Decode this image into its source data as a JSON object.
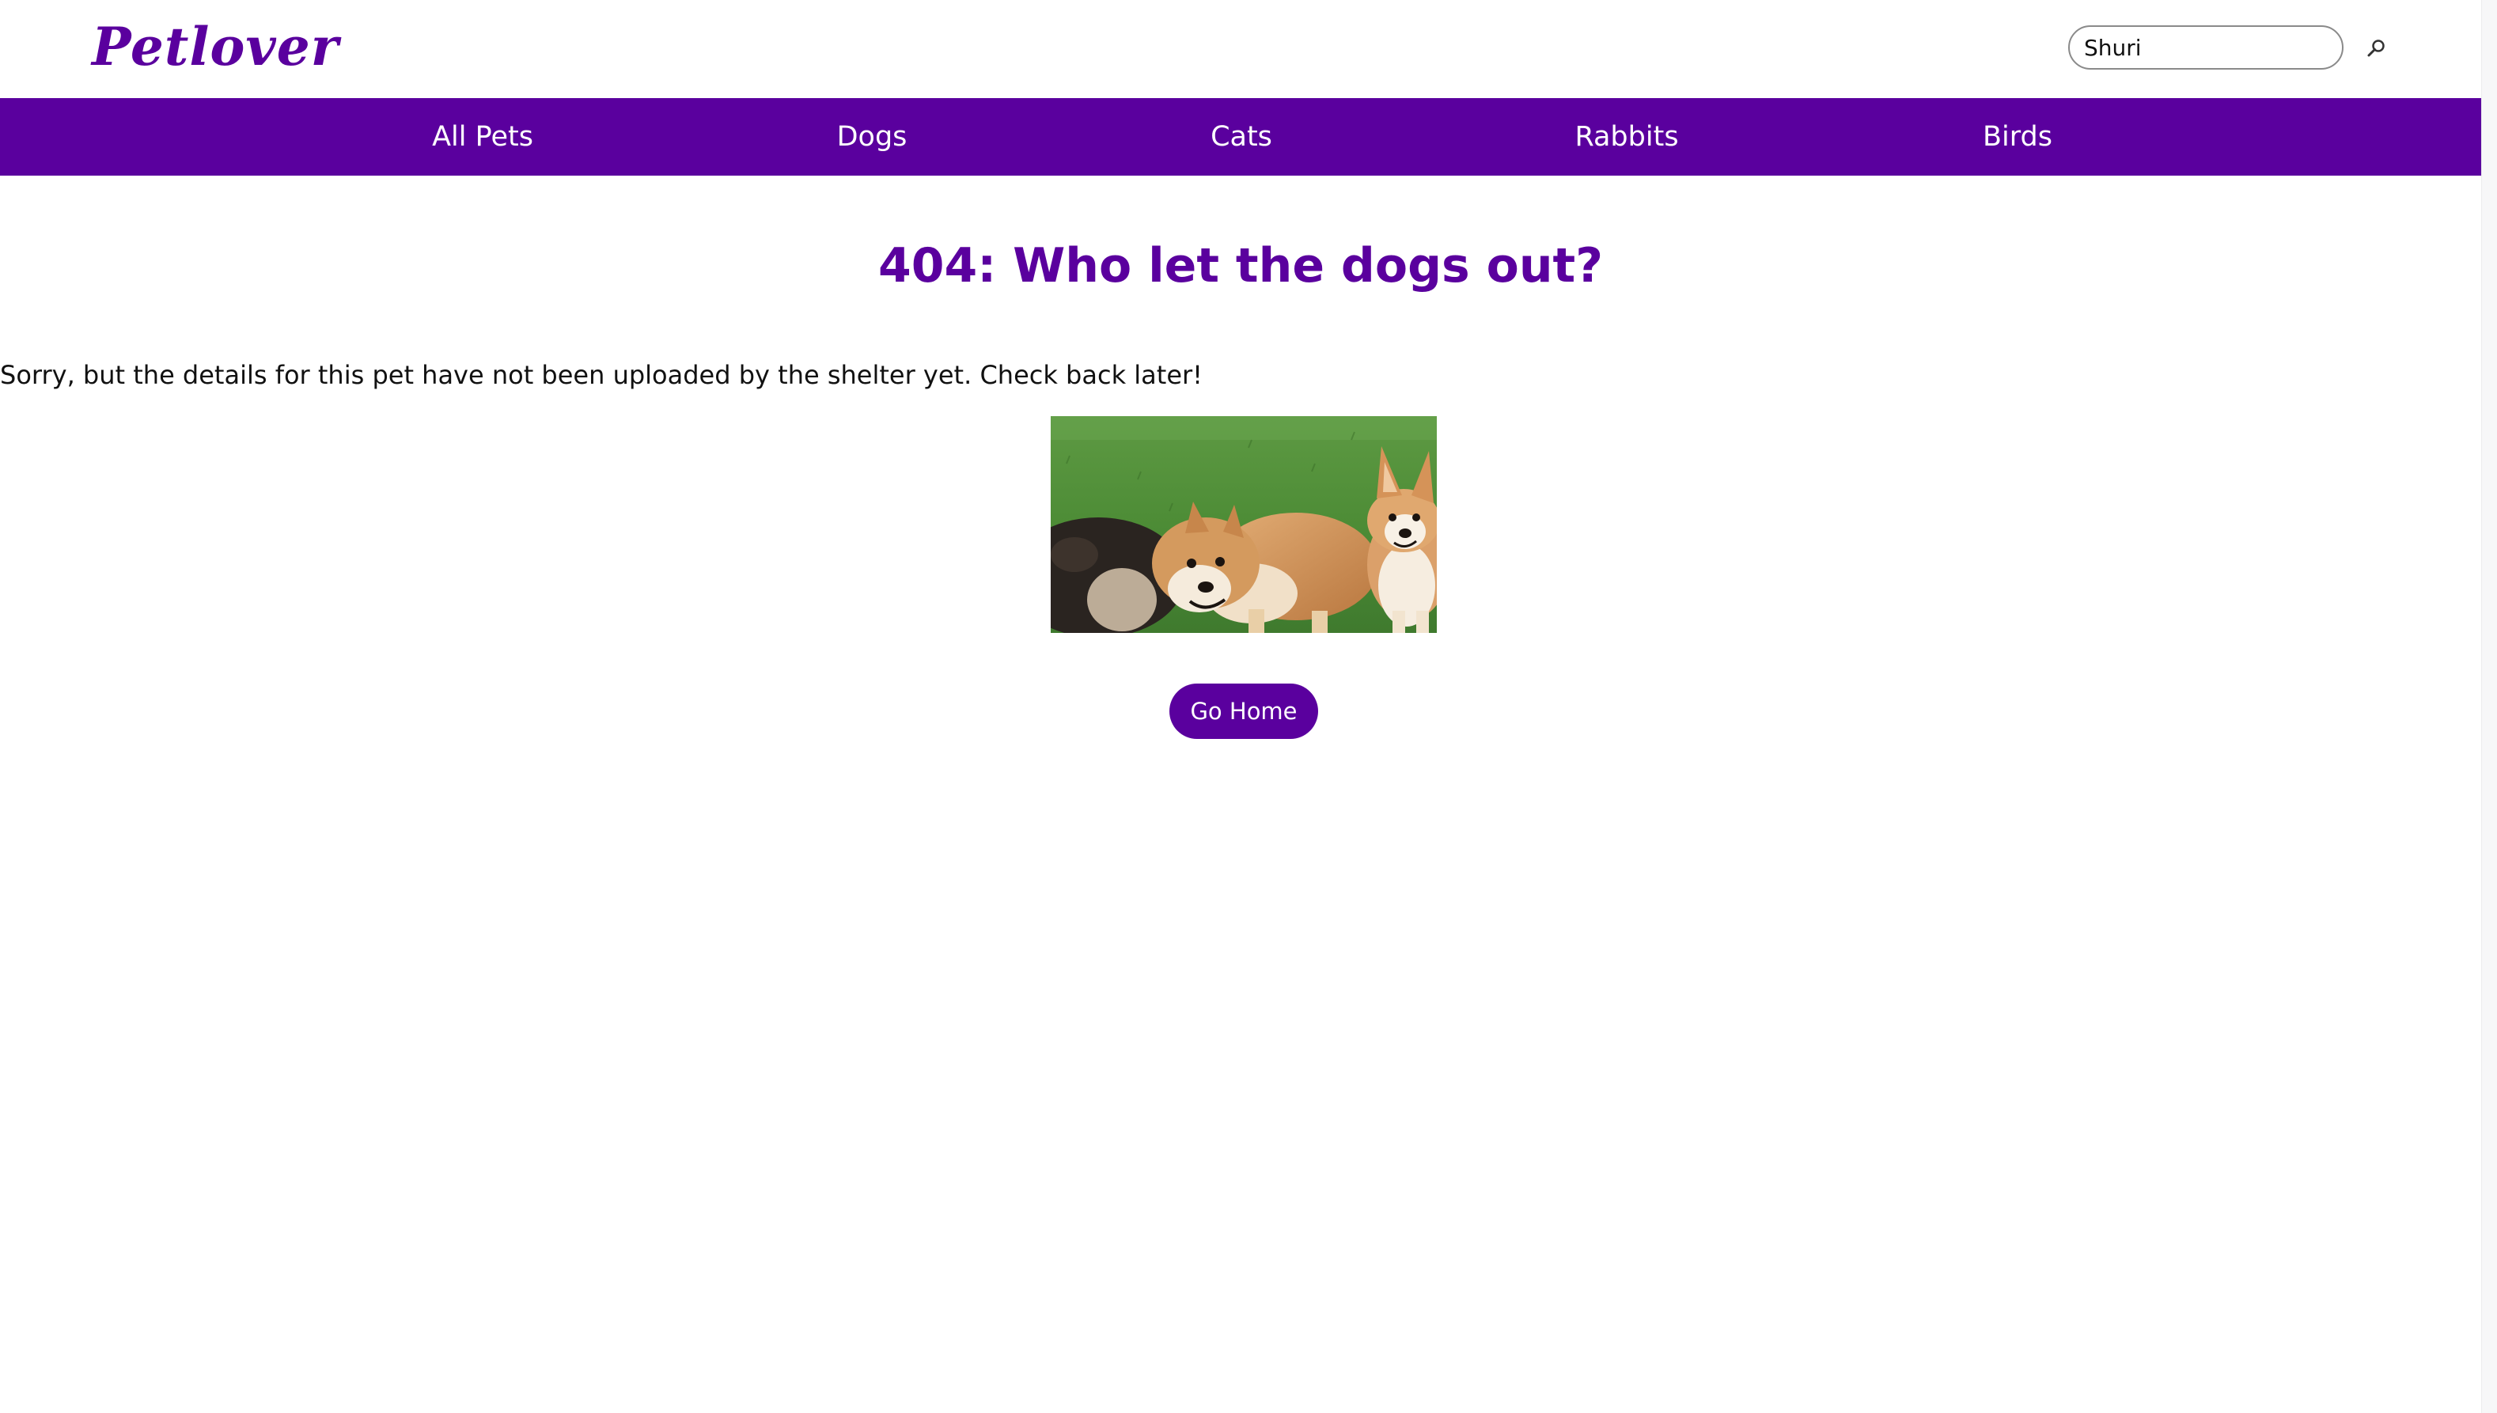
{
  "header": {
    "logo_text": "Petlover",
    "search": {
      "value": "Shuri",
      "placeholder": "Search"
    },
    "search_button_icon": "magnifier-icon"
  },
  "nav": {
    "items": [
      {
        "label": "All Pets"
      },
      {
        "label": "Dogs"
      },
      {
        "label": "Cats"
      },
      {
        "label": "Rabbits"
      },
      {
        "label": "Birds"
      }
    ]
  },
  "main": {
    "title": "404: Who let the dogs out?",
    "message": "Sorry, but the details for this pet have not been uploaded by the shelter yet. Check back later!",
    "image_alt": "Corgis running on grass",
    "home_button_label": "Go Home"
  },
  "colors": {
    "brand_purple": "#5a009e",
    "nav_text": "#ffffff",
    "body_text": "#111111"
  }
}
